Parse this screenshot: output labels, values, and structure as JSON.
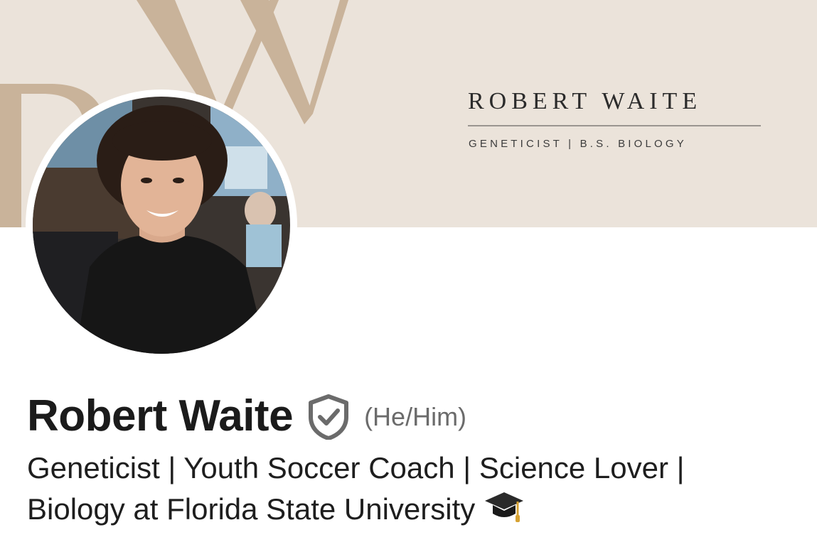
{
  "banner": {
    "name": "ROBERT WAITE",
    "subtitle": "GENETICIST | B.S. BIOLOGY",
    "background_color": "#ebe3da",
    "monogram_color": "#c9b39a",
    "monogram_letters": "RW"
  },
  "profile": {
    "avatar": "profile-photo",
    "name": "Robert Waite",
    "verified_icon": "shield-check-icon",
    "pronouns": "(He/Him)",
    "headline_line1": "Geneticist | Youth Soccer Coach | Science Lover |",
    "headline_line2": "Biology at Florida State University",
    "headline_icon": "graduation-cap-icon"
  }
}
